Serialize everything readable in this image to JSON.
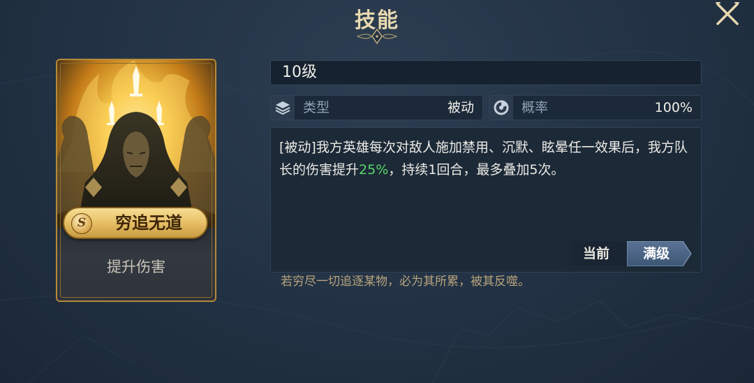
{
  "header": {
    "title": "技能"
  },
  "card": {
    "rank_badge": "S",
    "skill_name": "穷追无道",
    "tag": "提升伤害"
  },
  "detail": {
    "level": "10级",
    "type_label": "类型",
    "type_value": "被动",
    "rate_label": "概率",
    "rate_value": "100%",
    "description_pre": "[被动]我方英雄每次对敌人施加禁用、沉默、眩晕任一效果后，我方队长的伤害提升",
    "description_highlight": "25%",
    "description_post": "，持续1回合，最多叠加5次。",
    "highlight_color": "#58d968",
    "tabs": {
      "current": "当前",
      "max": "满级",
      "selected": "max"
    },
    "flavor_text": "若穷尽一切追逐某物，必为其所累，被其反噬。"
  },
  "icons": {
    "close": "close-icon",
    "type": "layers-icon",
    "rate": "pie-chart-icon"
  }
}
